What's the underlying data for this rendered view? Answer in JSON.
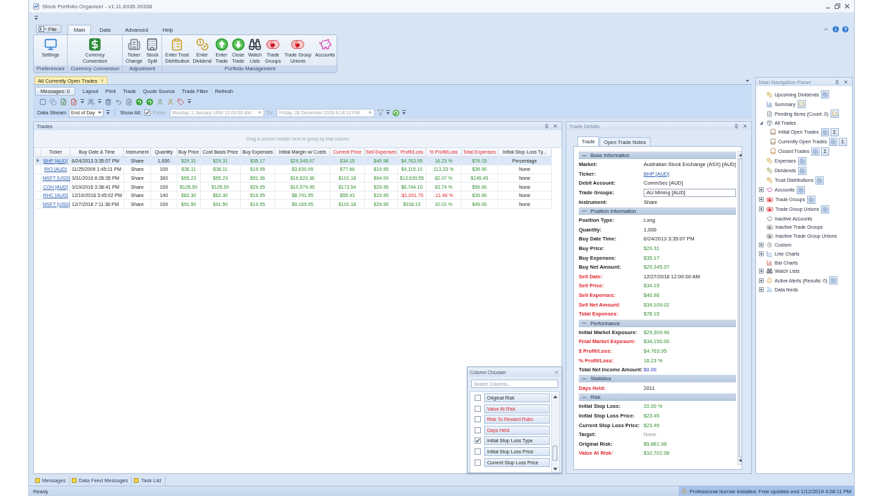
{
  "window": {
    "title": "Stock Portfolio Organizer - v1.11.6935.39338"
  },
  "ribbon": {
    "file_button": "File",
    "tabs": [
      {
        "label": "Main",
        "selected": true
      },
      {
        "label": "Data",
        "selected": false
      },
      {
        "label": "Advanced",
        "selected": false
      },
      {
        "label": "Help",
        "selected": false
      }
    ],
    "groups": [
      {
        "label": "Preferences",
        "buttons": [
          "Settings"
        ]
      },
      {
        "label": "Currency Conversion",
        "buttons": [
          "Currency\nConversion"
        ]
      },
      {
        "label": "Adjustment",
        "buttons": [
          "Ticker\nChange",
          "Stock\nSplit"
        ]
      },
      {
        "label": "Portfolio Management",
        "buttons": [
          "Enter Trust\nDistribution",
          "Enter\nDividend",
          "Enter\nTrade",
          "Close\nTrade",
          "Watch\nLists",
          "Trade\nGroups",
          "Trade Group\nUnions",
          "Accounts"
        ]
      }
    ]
  },
  "doc_tabs": [
    {
      "label": "All Currently Open Trades",
      "selected": true
    }
  ],
  "toolbar": {
    "messages_button": "Messages: 0",
    "menu": [
      "Layout",
      "Print",
      "Trade",
      "Quote Source",
      "Trade Filter",
      "Refresh"
    ]
  },
  "filter": {
    "data_stream_label": "Data Stream",
    "data_stream": "End of Day",
    "show_all_label": "Show All:",
    "show_all_checked": true,
    "from_label": "From:",
    "from": "Monday, 1 January 1990 12:00:00 AM",
    "to_label": "To:",
    "to": "Friday, 28 December 2018 6:14:12 PM",
    "dates_disabled": true
  },
  "trades_panel": {
    "title": "Trades",
    "active": true,
    "group_hint": "Drag a column header here to group by that column",
    "columns": [
      {
        "label": "Ticker",
        "kind": "link",
        "highlighted": false
      },
      {
        "label": "Buy Date & Time",
        "kind": "date",
        "highlighted": false
      },
      {
        "label": "Instrument",
        "kind": "text",
        "highlighted": false
      },
      {
        "label": "Quantity",
        "kind": "text",
        "highlighted": false
      },
      {
        "label": "Buy Price",
        "kind": "money",
        "highlighted": false
      },
      {
        "label": "Cost Basis Price",
        "kind": "money",
        "highlighted": false
      },
      {
        "label": "Buy Expenses",
        "kind": "money",
        "highlighted": false
      },
      {
        "label": "Initial Margin w/ Costs",
        "kind": "money",
        "highlighted": false
      },
      {
        "label": "Current Price",
        "kind": "money",
        "highlighted": true
      },
      {
        "label": "Sell Expenses",
        "kind": "money",
        "highlighted": true
      },
      {
        "label": "Profit/Loss",
        "kind": "profit",
        "highlighted": true
      },
      {
        "label": "% Profit/Loss",
        "kind": "profit",
        "highlighted": true
      },
      {
        "label": "Total Expenses",
        "kind": "money",
        "highlighted": true
      },
      {
        "label": "Initial Stop Loss Ty...",
        "kind": "text",
        "highlighted": false
      }
    ],
    "rows": [
      {
        "selected": true,
        "loss": false,
        "cells": [
          "BHP [AUD]",
          "6/24/2013 3:35:07 PM",
          "Share",
          "1,000",
          "$29.31",
          "$29.31",
          "$35.17",
          "$29,345.07",
          "$34.15",
          "$40.98",
          "$4,763.95",
          "16.23 %",
          "$76.15",
          "Percentage"
        ]
      },
      {
        "selected": false,
        "loss": false,
        "cells": [
          "RIO [AUD]",
          "11/25/2009 1:45:11 PM",
          "Share",
          "100",
          "$36.11",
          "$36.11",
          "$19.95",
          "$3,630.95",
          "$77.66",
          "$19.95",
          "$4,115.10",
          "113.33 %",
          "$39.90",
          "None"
        ]
      },
      {
        "selected": false,
        "loss": false,
        "cells": [
          "MSFT [USD]",
          "3/31/2016 8:28:35 PM",
          "Share",
          "300",
          "$55.23",
          "$55.23",
          "$51.36",
          "$16,620.36",
          "$101.18",
          "$94.09",
          "$13,639.55",
          "82.07 %",
          "$145.45",
          "None"
        ]
      },
      {
        "selected": false,
        "loss": false,
        "cells": [
          "COH [AUD]",
          "3/19/2016 3:38:41 PM",
          "Share",
          "100",
          "$105.50",
          "$105.50",
          "$29.95",
          "$10,579.95",
          "$173.54",
          "$29.95",
          "$6,744.10",
          "63.74 %",
          "$59.90",
          "None"
        ]
      },
      {
        "selected": false,
        "loss": true,
        "cells": [
          "RHC [AUD]",
          "12/19/2016 3:45:02 PM",
          "Share",
          "140",
          "$62.30",
          "$62.30",
          "$19.95",
          "$8,741.95",
          "$55.43",
          "$19.95",
          "-$1,001.70",
          "-11.46 %",
          "$39.90",
          "None"
        ]
      },
      {
        "selected": false,
        "loss": false,
        "cells": [
          "MSFT [USD]",
          "12/7/2018 7:11:36 PM",
          "Share",
          "100",
          "$91.50",
          "$91.50",
          "$19.95",
          "$9,169.95",
          "$101.18",
          "$29.95",
          "$918.10",
          "10.01 %",
          "$49.90",
          "None"
        ]
      }
    ]
  },
  "column_chooser": {
    "title": "Column Chooser",
    "placeholder": "Search Columns...",
    "items": [
      {
        "label": "Original Risk",
        "checked": false,
        "highlighted": false
      },
      {
        "label": "Value At Risk",
        "checked": false,
        "highlighted": true
      },
      {
        "label": "Risk To Reward Ratio",
        "checked": false,
        "highlighted": true
      },
      {
        "label": "Days Held",
        "checked": false,
        "highlighted": true
      },
      {
        "label": "Initial Stop Loss Type",
        "checked": true,
        "highlighted": false
      },
      {
        "label": "Initial Stop Loss Price",
        "checked": false,
        "highlighted": false
      },
      {
        "label": "Current Stop Loss Price",
        "checked": false,
        "highlighted": false
      }
    ]
  },
  "trade_details": {
    "title": "Trade Details",
    "active": false,
    "tabs": [
      {
        "label": "Trade",
        "selected": true
      },
      {
        "label": "Open Trade Notes",
        "selected": false
      }
    ],
    "sections": [
      {
        "title": "Base Information",
        "expanded": true,
        "rows": [
          {
            "label": "Market:",
            "value": "Australian Stock Exchange (ASX) [AUD]",
            "kind": "text",
            "color": "#1f1f1f"
          },
          {
            "label": "Ticker:",
            "value": "BHP [AUD]",
            "kind": "link",
            "color": "#1f1f1f"
          },
          {
            "label": "Debit Account:",
            "value": "CommSec [AUD]",
            "kind": "text",
            "color": "#1f1f1f"
          },
          {
            "label": "Trade Groups:",
            "value": "AU Mining [AUD]",
            "kind": "field",
            "color": "#1f1f1f"
          },
          {
            "label": "Instrument:",
            "value": "Share",
            "kind": "text",
            "color": "#1f1f1f"
          }
        ]
      },
      {
        "title": "Position Information",
        "expanded": true,
        "rows": [
          {
            "label": "Position Type:",
            "value": "Long",
            "kind": "text",
            "color": "#1f1f1f"
          },
          {
            "label": "Quantity:",
            "value": "1,000",
            "kind": "text",
            "color": "#1f1f1f"
          },
          {
            "label": "Buy Date Time:",
            "value": "6/24/2013 3:35:07 PM",
            "kind": "text",
            "color": "#1f1f1f"
          },
          {
            "label": "Buy Price:",
            "value": "$29.31",
            "kind": "figure",
            "color": "#1f1f1f"
          },
          {
            "label": "Buy Expenses:",
            "value": "$35.17",
            "kind": "figure",
            "color": "#1f1f1f"
          },
          {
            "label": "Buy Net Amount:",
            "value": "$29,345.07",
            "kind": "figure",
            "color": "#1f1f1f"
          },
          {
            "label": "Sell Date:",
            "value": "12/27/2018 12:00:00 AM",
            "kind": "text",
            "color": "#e0242c"
          },
          {
            "label": "Sell Price:",
            "value": "$34.15",
            "kind": "figure",
            "color": "#e0242c"
          },
          {
            "label": "Sell Expenses:",
            "value": "$40.98",
            "kind": "figure",
            "color": "#e0242c"
          },
          {
            "label": "Sell Net Amount:",
            "value": "$34,109.02",
            "kind": "figure",
            "color": "#e0242c"
          },
          {
            "label": "Total Expenses:",
            "value": "$76.15",
            "kind": "figure",
            "color": "#e0242c"
          }
        ]
      },
      {
        "title": "Performance",
        "expanded": true,
        "rows": [
          {
            "label": "Initial Market Exposure:",
            "value": "$29,309.90",
            "kind": "figure",
            "color": "#1f1f1f"
          },
          {
            "label": "Final Market Exposure:",
            "value": "$34,150.00",
            "kind": "figure",
            "color": "#e0242c"
          },
          {
            "label": "$ Profit/Loss:",
            "value": "$4,763.95",
            "kind": "figure",
            "color": "#e0242c"
          },
          {
            "label": "% Profit/Loss:",
            "value": "16.23 %",
            "kind": "figure",
            "color": "#e0242c"
          },
          {
            "label": "Total Net Income Amount:",
            "value": "$0.00",
            "kind": "total",
            "color": "#1f1f1f"
          }
        ]
      },
      {
        "title": "Statistics",
        "expanded": true,
        "rows": [
          {
            "label": "Days Held:",
            "value": "2011",
            "kind": "text",
            "color": "#e0242c"
          }
        ]
      },
      {
        "title": "Risk",
        "expanded": true,
        "rows": [
          {
            "label": "Initial Stop Loss:",
            "value": "20.00 %",
            "kind": "figure",
            "color": "#1f1f1f"
          },
          {
            "label": "Initial Stop Loss Price:",
            "value": "$23.45",
            "kind": "figure",
            "color": "#1f1f1f"
          },
          {
            "label": "Current Stop Loss Price:",
            "value": "$23.45",
            "kind": "figure",
            "color": "#1f1f1f"
          },
          {
            "label": "Target:",
            "value": "None",
            "kind": "muted",
            "color": "#1f1f1f"
          },
          {
            "label": "Original Risk:",
            "value": "$5,861.98",
            "kind": "figure",
            "color": "#1f1f1f"
          },
          {
            "label": "Value At Risk:",
            "value": "$10,702.08",
            "kind": "figure",
            "color": "#e0242c"
          }
        ]
      }
    ]
  },
  "navigation": {
    "title": "Main Navigation Panel",
    "active": false,
    "items": [
      {
        "label": "Upcoming Dividends",
        "buttons": [
          {
            "kind": "grid"
          }
        ]
      },
      {
        "label": "Summary",
        "buttons": [
          {
            "kind": "folder"
          }
        ]
      },
      {
        "label": "Pending Items (Count: 0)",
        "buttons": [
          {
            "kind": "folder"
          }
        ]
      },
      {
        "label": "All Trades",
        "expanded": true,
        "children": [
          {
            "label": "Initial Open Trades",
            "buttons": [
              {
                "kind": "grid"
              },
              {
                "kind": "sum",
                "label": "Σ"
              }
            ]
          },
          {
            "label": "Currently Open Trades",
            "buttons": [
              {
                "kind": "grid"
              },
              {
                "kind": "sum",
                "label": "Σ"
              }
            ]
          },
          {
            "label": "Closed Trades",
            "buttons": [
              {
                "kind": "grid"
              },
              {
                "kind": "sum",
                "label": "Σ"
              }
            ]
          }
        ]
      },
      {
        "label": "Expenses",
        "buttons": [
          {
            "kind": "grid"
          }
        ]
      },
      {
        "label": "Dividends",
        "buttons": [
          {
            "kind": "grid"
          }
        ]
      },
      {
        "label": "Trust Distributions",
        "buttons": [
          {
            "kind": "grid"
          }
        ]
      },
      {
        "label": "Accounts",
        "expanded": false,
        "buttons": [
          {
            "kind": "grid"
          }
        ]
      },
      {
        "label": "Trade Groups",
        "expanded": false,
        "buttons": [
          {
            "kind": "grid"
          }
        ]
      },
      {
        "label": "Trade Group Unions",
        "expanded": false,
        "buttons": [
          {
            "kind": "grid"
          }
        ]
      },
      {
        "label": "Inactive Accounts"
      },
      {
        "label": "Inactive Trade Groups"
      },
      {
        "label": "Inactive Trade Group Unions"
      },
      {
        "label": "Custom",
        "expanded": false
      },
      {
        "label": "Line Charts",
        "expanded": false
      },
      {
        "label": "Bar Charts"
      },
      {
        "label": "Watch Lists",
        "expanded": false
      },
      {
        "label": "Active Alerts (Results: 0)",
        "expanded": false,
        "buttons": [
          {
            "kind": "grid"
          }
        ]
      },
      {
        "label": "Data feeds",
        "expanded": false
      }
    ]
  },
  "bottom_tabs": [
    "Messages",
    "Data Feed Messages",
    "Task List"
  ],
  "status_bar": {
    "status": "Ready",
    "license": "Professional license installed. Free updates end 1/12/2019 4:08:11 PM"
  }
}
